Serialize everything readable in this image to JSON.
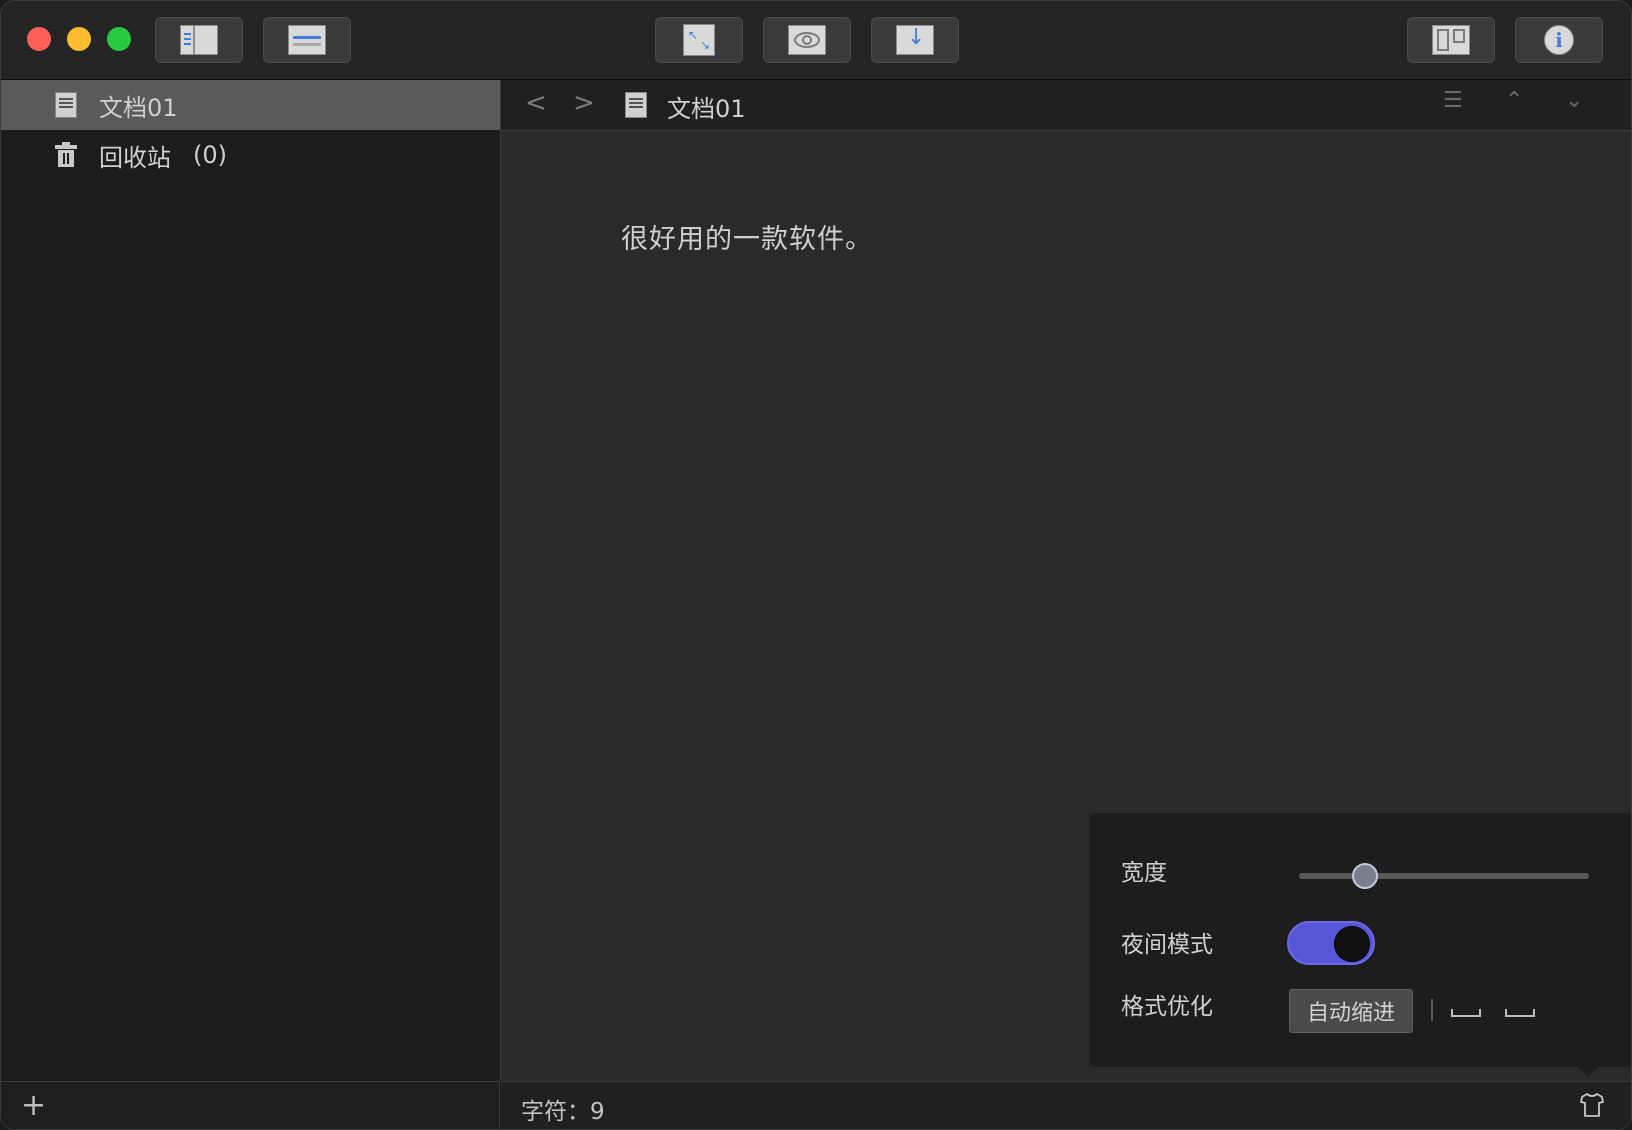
{
  "toolbar": {
    "buttons": [
      {
        "icon": "sidebar-toggle-icon"
      },
      {
        "icon": "list-view-icon"
      },
      {
        "icon": "fullscreen-icon"
      },
      {
        "icon": "preview-eye-icon"
      },
      {
        "icon": "export-download-icon"
      },
      {
        "icon": "split-view-icon"
      },
      {
        "icon": "info-icon"
      }
    ]
  },
  "sidebar": {
    "items": [
      {
        "label": "文档01",
        "icon": "document-icon",
        "selected": true
      },
      {
        "label": "回收站",
        "count": "(0)",
        "icon": "trash-icon",
        "selected": false
      }
    ],
    "add_label": "+"
  },
  "editor": {
    "title": "文档01",
    "content": "很好用的一款软件。"
  },
  "status": {
    "char_count": "字符：9"
  },
  "settings_popover": {
    "width_label": "宽度",
    "width_value": 0.2,
    "night_mode_label": "夜间模式",
    "night_mode_on": true,
    "format_label": "格式优化",
    "auto_indent_label": "自动缩进"
  },
  "colors": {
    "accent": "#5855d6",
    "selected_row": "#5a5a5a",
    "icon_blue": "#3f7fd9"
  }
}
